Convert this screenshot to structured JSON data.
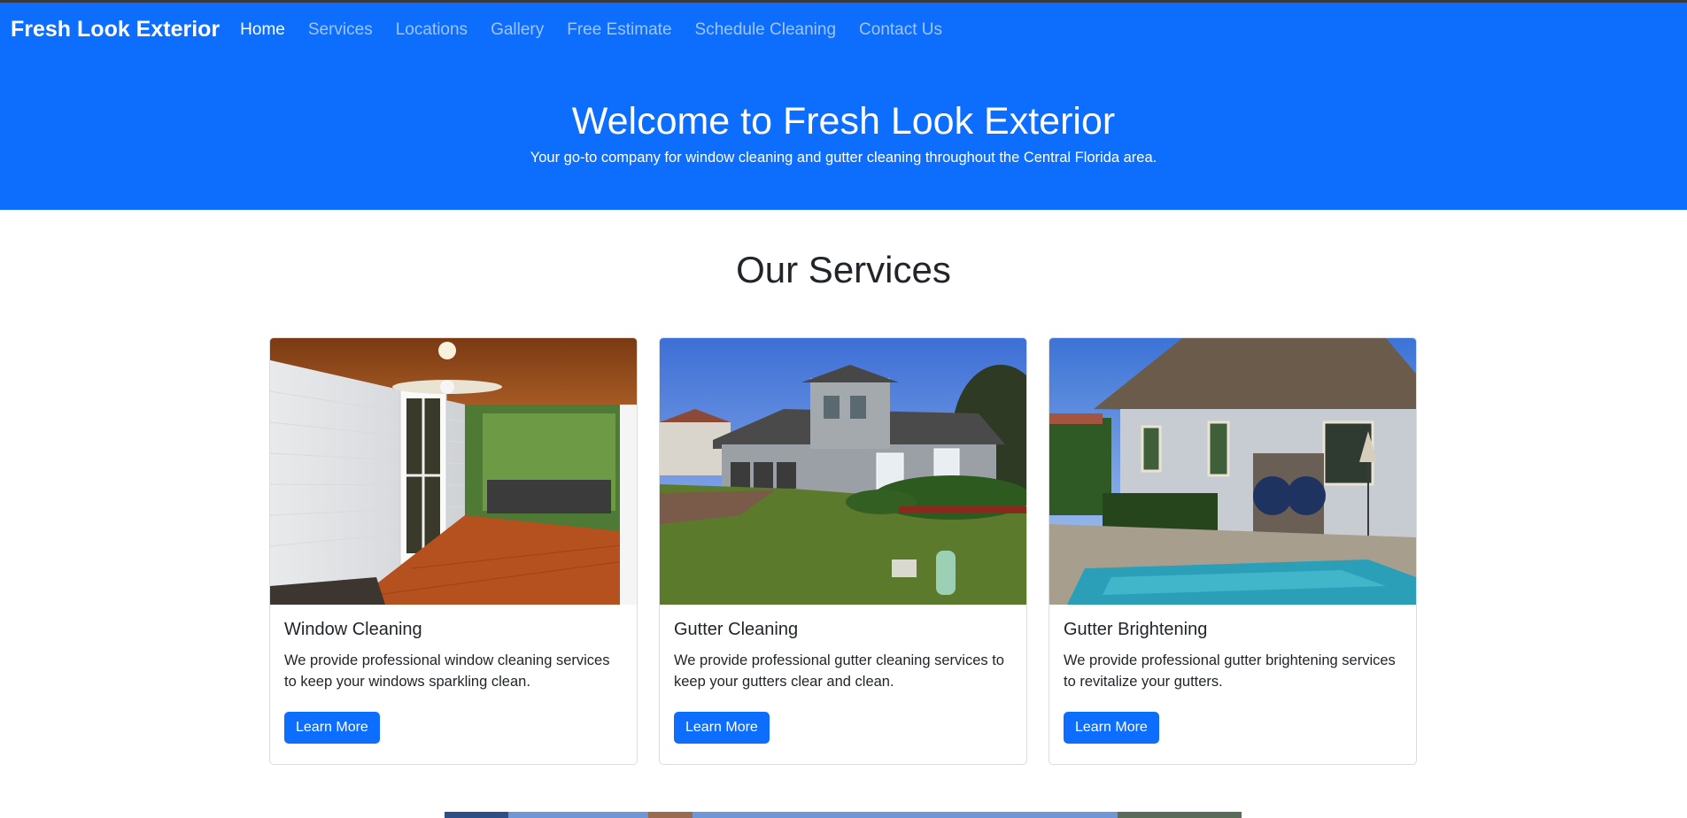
{
  "nav": {
    "brand": "Fresh Look Exterior",
    "links": [
      {
        "label": "Home",
        "active": true
      },
      {
        "label": "Services"
      },
      {
        "label": "Locations"
      },
      {
        "label": "Gallery"
      },
      {
        "label": "Free Estimate"
      },
      {
        "label": "Schedule Cleaning"
      },
      {
        "label": "Contact Us"
      }
    ]
  },
  "hero": {
    "title": "Welcome to Fresh Look Exterior",
    "subtitle": "Your go-to company for window cleaning and gutter cleaning throughout the Central Florida area."
  },
  "services": {
    "heading": "Our Services",
    "cards": [
      {
        "title": "Window Cleaning",
        "text": "We provide professional window cleaning services to keep your windows sparkling clean.",
        "button": "Learn More"
      },
      {
        "title": "Gutter Cleaning",
        "text": "We provide professional gutter cleaning services to keep your gutters clear and clean.",
        "button": "Learn More"
      },
      {
        "title": "Gutter Brightening",
        "text": "We provide professional gutter brightening services to revitalize your gutters.",
        "button": "Learn More"
      }
    ]
  },
  "colors": {
    "primary": "#0d6efd",
    "nav_link_muted": "rgba(255,255,255,0.6)"
  }
}
